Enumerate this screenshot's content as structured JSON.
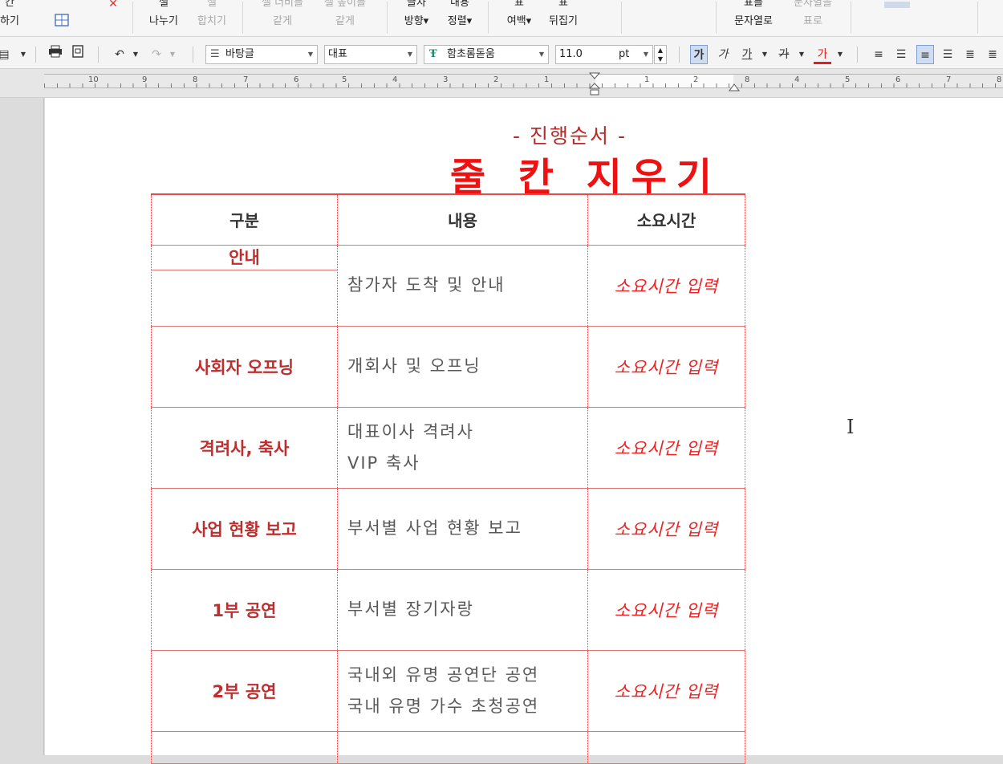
{
  "ribbon": {
    "items": [
      {
        "l1": "칸",
        "l2": "하기"
      },
      {
        "l1": "셀",
        "l2": "나누기"
      },
      {
        "l1": "셀",
        "l2": "합치기",
        "disabled": true
      },
      {
        "l1": "셀 너비를",
        "l2": "같게",
        "disabled": true
      },
      {
        "l1": "셀 높이를",
        "l2": "같게",
        "disabled": true
      },
      {
        "l1": "글자",
        "l2": "방향▾"
      },
      {
        "l1": "내용",
        "l2": "정렬▾"
      },
      {
        "l1": "표",
        "l2": "여백▾"
      },
      {
        "l1": "표",
        "l2": "뒤집기"
      },
      {
        "l1": "표를",
        "l2": "문자열로"
      },
      {
        "l1": "문자열을",
        "l2": "표로",
        "disabled": true
      }
    ]
  },
  "toolbar": {
    "style": "바탕글",
    "language": "대표",
    "font": "함초롬돋움",
    "font_size": "11.0",
    "unit": "pt",
    "bold_label": "가",
    "italic_label": "가",
    "underline_label": "가",
    "strike_label": "가",
    "color_label": "가",
    "accent_color": "#e02020"
  },
  "ruler": {
    "numbers_left": [
      "10",
      "9",
      "8",
      "7",
      "6",
      "5",
      "4",
      "3",
      "2",
      "1"
    ],
    "numbers_right": [
      "1",
      "2",
      "8",
      "4",
      "5",
      "6",
      "7",
      "8"
    ]
  },
  "document": {
    "subtitle": "- 진행순서 -",
    "title": "줄 칸 지우기",
    "headers": [
      "구분",
      "내용",
      "소요시간"
    ],
    "rows": [
      {
        "category": "안내",
        "content": [
          "참가자 도착 및 안내"
        ],
        "time": "소요시간 입력"
      },
      {
        "category": "사회자 오프닝",
        "content": [
          "개회사 및 오프닝"
        ],
        "time": "소요시간 입력"
      },
      {
        "category": "격려사, 축사",
        "content": [
          "대표이사 격려사",
          "VIP 축사"
        ],
        "time": "소요시간 입력"
      },
      {
        "category": "사업 현황 보고",
        "content": [
          "부서별 사업 현황 보고"
        ],
        "time": "소요시간 입력"
      },
      {
        "category": "1부 공연",
        "content": [
          "부서별 장기자랑"
        ],
        "time": "소요시간 입력"
      },
      {
        "category": "2부 공연",
        "content": [
          "국내외 유명 공연단 공연",
          "국내 유명 가수 초청공연"
        ],
        "time": "소요시간 입력"
      }
    ]
  }
}
